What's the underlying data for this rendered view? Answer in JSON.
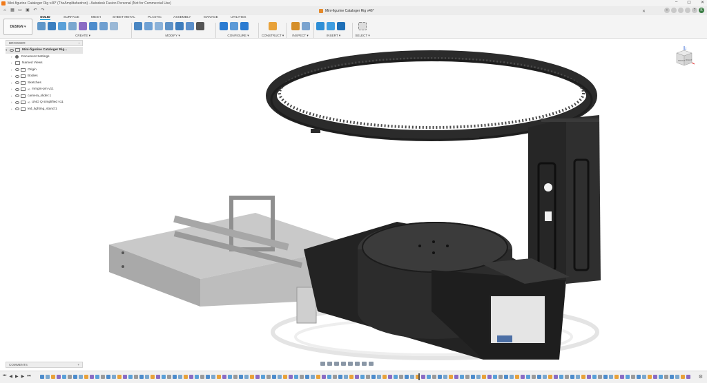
{
  "titlebar": {
    "title": "Mini-figurine Cataloger Rig v46* (TheAmplituhedron) - Autodesk Fusion Personal (Not for Commercial Use)",
    "controls": [
      "–",
      "▢",
      "✕"
    ]
  },
  "quickbar": {
    "doc_tab_title": "Mini-figurine Cataloger Rig v46*",
    "close_glyph": "✕",
    "user_initials": "K"
  },
  "ribbon": {
    "workspace_label": "DESIGN ▾",
    "tabs": [
      "SOLID",
      "SURFACE",
      "MESH",
      "SHEET METAL",
      "PLASTIC",
      "ASSEMBLY",
      "MANAGE",
      "UTILITIES"
    ],
    "active_tab": "SOLID",
    "groups": [
      "CREATE ▾",
      "MODIFY ▾",
      "CONFIGURE ▾",
      "CONSTRUCT ▾",
      "INSPECT ▾",
      "INSERT ▾",
      "SELECT ▾"
    ]
  },
  "browser": {
    "header": "BROWSER",
    "minimize_glyph": "–",
    "root": "Mini-figurine Cataloger Rig...",
    "items": [
      "Document Settings",
      "Named Views",
      "Origin",
      "Bodies",
      "Sketches",
      "mmgm-pm v11",
      "camera_slider:1",
      "UNO Q simplified v11",
      "led_lighting_stand:1"
    ]
  },
  "viewcube": {
    "top": "TOP",
    "front": "FRONT",
    "right": "RIGHT",
    "axis_z": "Z"
  },
  "comments": {
    "label": "COMMENTS",
    "add_glyph": "+"
  },
  "colors": {
    "accent": "#0696d7",
    "model_dark": "#2a2a2a",
    "model_light": "#bdbdbd",
    "app_orange": "#f07a1a"
  }
}
